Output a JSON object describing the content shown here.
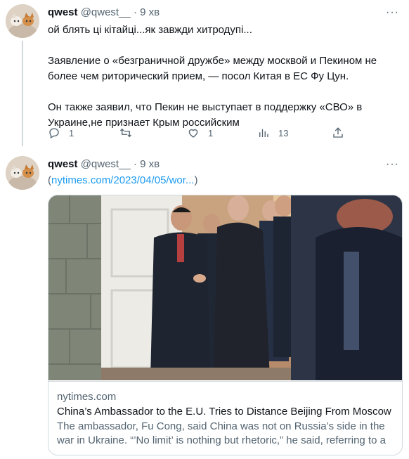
{
  "tweets": [
    {
      "name": "qwest",
      "handle": "@qwest__",
      "time": "9 хв",
      "lines": [
        "ой блять ці кітайці...як завжди хитродупі...",
        "Заявление о «безграничной дружбе» между москвой и Пекином не более чем риторический прием, — посол Китая в ЕС Фу Цун.",
        "Он также заявил, что Пекин не выступает в поддержку «СВО» в Украине,не признает Крым российским"
      ],
      "actions": {
        "reply_count": "1",
        "retweet_count": "",
        "like_count": "1",
        "views_count": "13"
      }
    },
    {
      "name": "qwest",
      "handle": "@qwest__",
      "time": "9 хв",
      "link_open": "(",
      "link_text": "nytimes.com/2023/04/05/wor...",
      "link_close": ")",
      "card": {
        "domain": "nytimes.com",
        "title": "China’s Ambassador to the E.U. Tries to Distance Beijing From Moscow",
        "description": "The ambassador, Fu Cong, said China was not on Russia’s side in the war in Ukraine. “’No limit’ is nothing but rhetoric,” he said, referring to a ..."
      }
    }
  ],
  "icons": {
    "more": "more-dots-icon",
    "reply": "reply-icon",
    "retweet": "retweet-icon",
    "like": "heart-icon",
    "views": "views-icon",
    "share": "share-icon"
  },
  "colors": {
    "text": "#0f1419",
    "secondary": "#536471",
    "link": "#1d9bf0",
    "border": "#cfd9de"
  }
}
